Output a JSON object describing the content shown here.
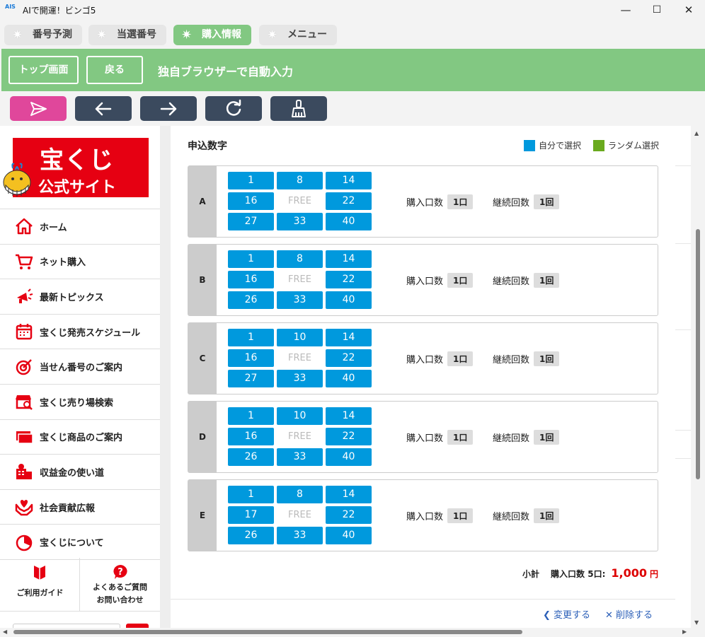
{
  "window": {
    "logo_text": "AIS",
    "title": "AIで開運！ビンゴ5",
    "minimize": "—",
    "maximize": "☐",
    "close": "✕"
  },
  "tabs": [
    {
      "label": "番号予測",
      "icon": "star-icon",
      "active": false
    },
    {
      "label": "当選番号",
      "icon": "star-icon",
      "active": false
    },
    {
      "label": "購入情報",
      "icon": "star-icon",
      "active": true
    },
    {
      "label": "メニュー",
      "icon": "star-icon",
      "active": false
    }
  ],
  "toolbar": {
    "top_button": "トップ画面",
    "back_button": "戻る",
    "title": "独自ブラウザーで自動入力"
  },
  "nav_icons": [
    "send-icon",
    "arrow-left-icon",
    "arrow-right-icon",
    "reload-icon",
    "broom-icon"
  ],
  "sidebar": {
    "logo_line1": "宝くじ",
    "logo_line2": "公式サイト",
    "items": [
      {
        "label": "ホーム",
        "icon": "home-icon"
      },
      {
        "label": "ネット購入",
        "icon": "cart-icon"
      },
      {
        "label": "最新トピックス",
        "icon": "megaphone-icon"
      },
      {
        "label": "宝くじ発売スケジュール",
        "icon": "calendar-icon"
      },
      {
        "label": "当せん番号のご案内",
        "icon": "target-icon"
      },
      {
        "label": "宝くじ売り場検索",
        "icon": "shop-search-icon"
      },
      {
        "label": "宝くじ商品のご案内",
        "icon": "tickets-icon"
      },
      {
        "label": "収益金の使い道",
        "icon": "building-icon"
      },
      {
        "label": "社会貢献広報",
        "icon": "heart-hands-icon"
      },
      {
        "label": "宝くじについて",
        "icon": "pie-icon"
      }
    ],
    "guide": "ご利用ガイド",
    "faq_line1": "よくあるご質問",
    "faq_line2": "お問い合わせ"
  },
  "main": {
    "section_title": "申込数字",
    "legend": [
      {
        "label": "自分で選択",
        "color": "#0099dd"
      },
      {
        "label": "ランダム選択",
        "color": "#6aaa1e"
      }
    ],
    "free_label": "FREE",
    "quantity_label": "購入口数",
    "repeat_label": "継続回数",
    "rows": [
      {
        "letter": "A",
        "numbers": [
          "1",
          "8",
          "14",
          "16",
          "FREE",
          "22",
          "27",
          "33",
          "40"
        ],
        "quantity": "1口",
        "repeat": "1回"
      },
      {
        "letter": "B",
        "numbers": [
          "1",
          "8",
          "14",
          "16",
          "FREE",
          "22",
          "26",
          "33",
          "40"
        ],
        "quantity": "1口",
        "repeat": "1回"
      },
      {
        "letter": "C",
        "numbers": [
          "1",
          "10",
          "14",
          "16",
          "FREE",
          "22",
          "27",
          "33",
          "40"
        ],
        "quantity": "1口",
        "repeat": "1回"
      },
      {
        "letter": "D",
        "numbers": [
          "1",
          "10",
          "14",
          "16",
          "FREE",
          "22",
          "26",
          "33",
          "40"
        ],
        "quantity": "1口",
        "repeat": "1回"
      },
      {
        "letter": "E",
        "numbers": [
          "1",
          "8",
          "14",
          "17",
          "FREE",
          "22",
          "26",
          "33",
          "40"
        ],
        "quantity": "1口",
        "repeat": "1回"
      }
    ],
    "subtotal_label": "小計",
    "subtotal_detail": "購入口数 5口:",
    "subtotal_amount": "1,000",
    "subtotal_unit": "円",
    "change_link": "変更する",
    "delete_link": "削除する"
  }
}
